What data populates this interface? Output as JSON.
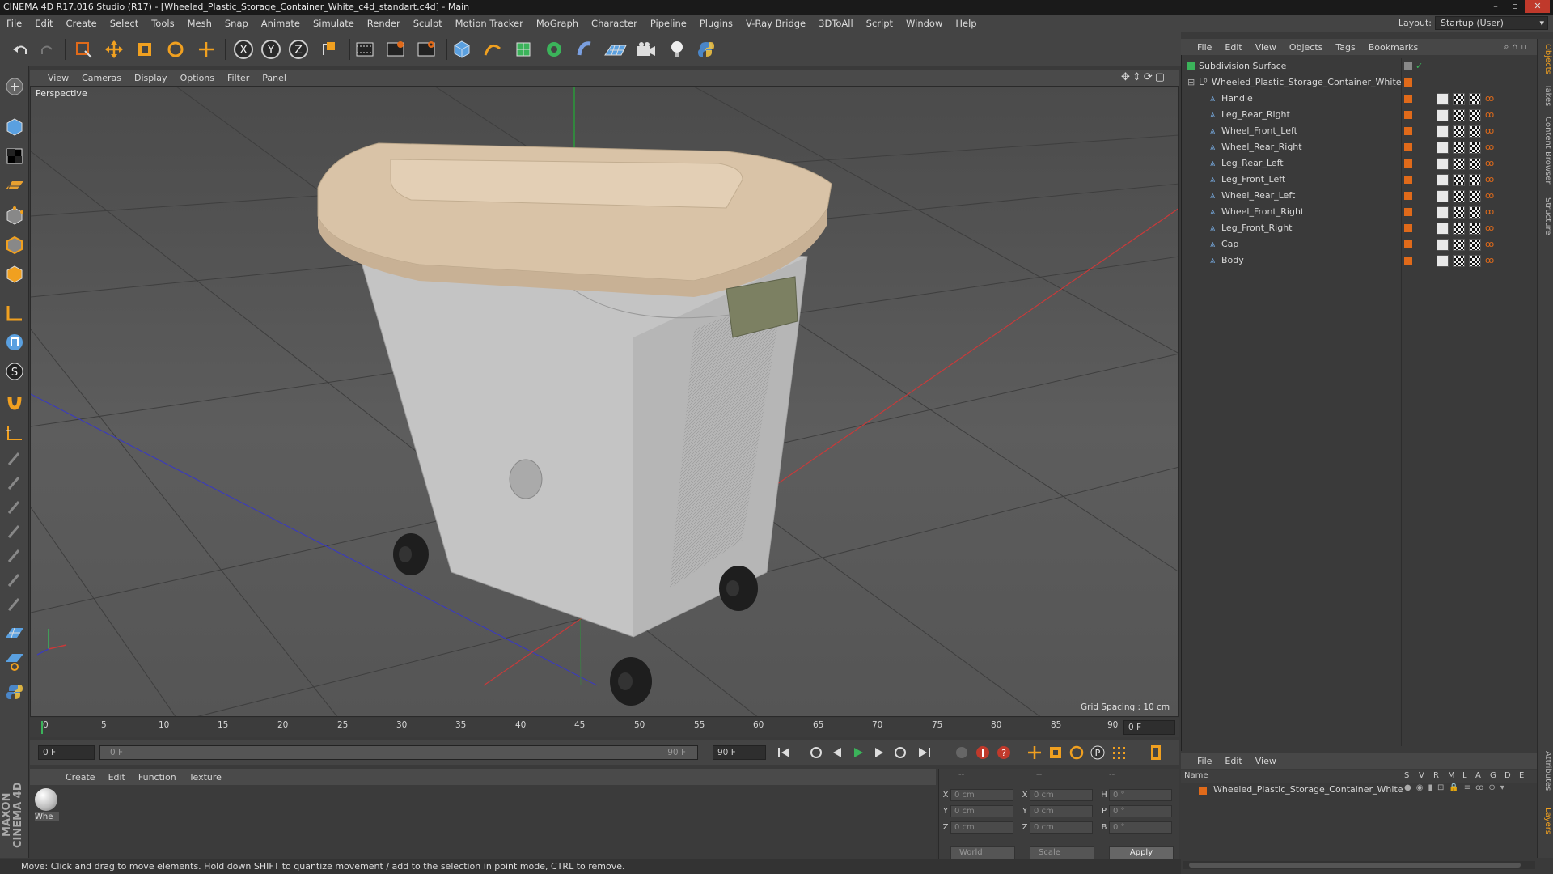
{
  "window": {
    "title": "CINEMA 4D R17.016 Studio (R17) - [Wheeled_Plastic_Storage_Container_White_c4d_standart.c4d] - Main"
  },
  "menubar": {
    "items": [
      "File",
      "Edit",
      "Create",
      "Select",
      "Tools",
      "Mesh",
      "Snap",
      "Animate",
      "Simulate",
      "Render",
      "Sculpt",
      "Motion Tracker",
      "MoGraph",
      "Character",
      "Pipeline",
      "Plugins",
      "V-Ray Bridge",
      "3DToAll",
      "Script",
      "Window",
      "Help"
    ],
    "layout_label": "Layout:",
    "layout_value": "Startup (User)"
  },
  "viewport": {
    "menu": [
      "View",
      "Cameras",
      "Display",
      "Options",
      "Filter",
      "Panel"
    ],
    "camera_label": "Perspective",
    "grid_spacing": "Grid Spacing : 10 cm"
  },
  "timeline": {
    "ticks": [
      "0",
      "5",
      "10",
      "15",
      "20",
      "25",
      "30",
      "35",
      "40",
      "45",
      "50",
      "55",
      "60",
      "65",
      "70",
      "75",
      "80",
      "85",
      "90"
    ],
    "current_frame_right": "0 F",
    "start_field": "0 F",
    "range_start": "0 F",
    "range_end": "90 F",
    "end_field": "90 F"
  },
  "material_manager": {
    "menu": [
      "Create",
      "Edit",
      "Function",
      "Texture"
    ],
    "material_label": "Whe"
  },
  "coordinates": {
    "header": [
      "--",
      "--",
      "--"
    ],
    "rows": [
      {
        "a": "X",
        "av": "0 cm",
        "b": "X",
        "bv": "0 cm",
        "c": "H",
        "cv": "0 °"
      },
      {
        "a": "Y",
        "av": "0 cm",
        "b": "Y",
        "bv": "0 cm",
        "c": "P",
        "cv": "0 °"
      },
      {
        "a": "Z",
        "av": "0 cm",
        "b": "Z",
        "bv": "0 cm",
        "c": "B",
        "cv": "0 °"
      }
    ],
    "world": "World",
    "scale": "Scale",
    "apply": "Apply"
  },
  "status": {
    "text": "Move: Click and drag to move elements. Hold down SHIFT to quantize movement / add to the selection in point mode, CTRL to remove."
  },
  "objects_panel": {
    "menu": [
      "File",
      "Edit",
      "View",
      "Objects",
      "Tags",
      "Bookmarks"
    ],
    "root": "Subdivision Surface",
    "group": "Wheeled_Plastic_Storage_Container_White",
    "children": [
      "Handle",
      "Leg_Rear_Right",
      "Wheel_Front_Left",
      "Wheel_Rear_Right",
      "Leg_Rear_Left",
      "Leg_Front_Left",
      "Wheel_Rear_Left",
      "Wheel_Front_Right",
      "Leg_Front_Right",
      "Cap",
      "Body"
    ]
  },
  "layers_panel": {
    "menu": [
      "File",
      "Edit",
      "View"
    ],
    "name_header": "Name",
    "col_headers": [
      "S",
      "V",
      "R",
      "M",
      "L",
      "A",
      "G",
      "D",
      "E"
    ],
    "layer_name": "Wheeled_Plastic_Storage_Container_White"
  },
  "right_tabs": [
    "Objects",
    "Takes",
    "Content Browser",
    "Structure",
    "Attributes",
    "Layers"
  ],
  "brand": "MAXON CINEMA 4D",
  "colors": {
    "accent_blue": "#2f6fb5",
    "orange_layer": "#e06a1a",
    "cap_color": "#d8c2a8",
    "body_color": "#c8c8c8"
  }
}
